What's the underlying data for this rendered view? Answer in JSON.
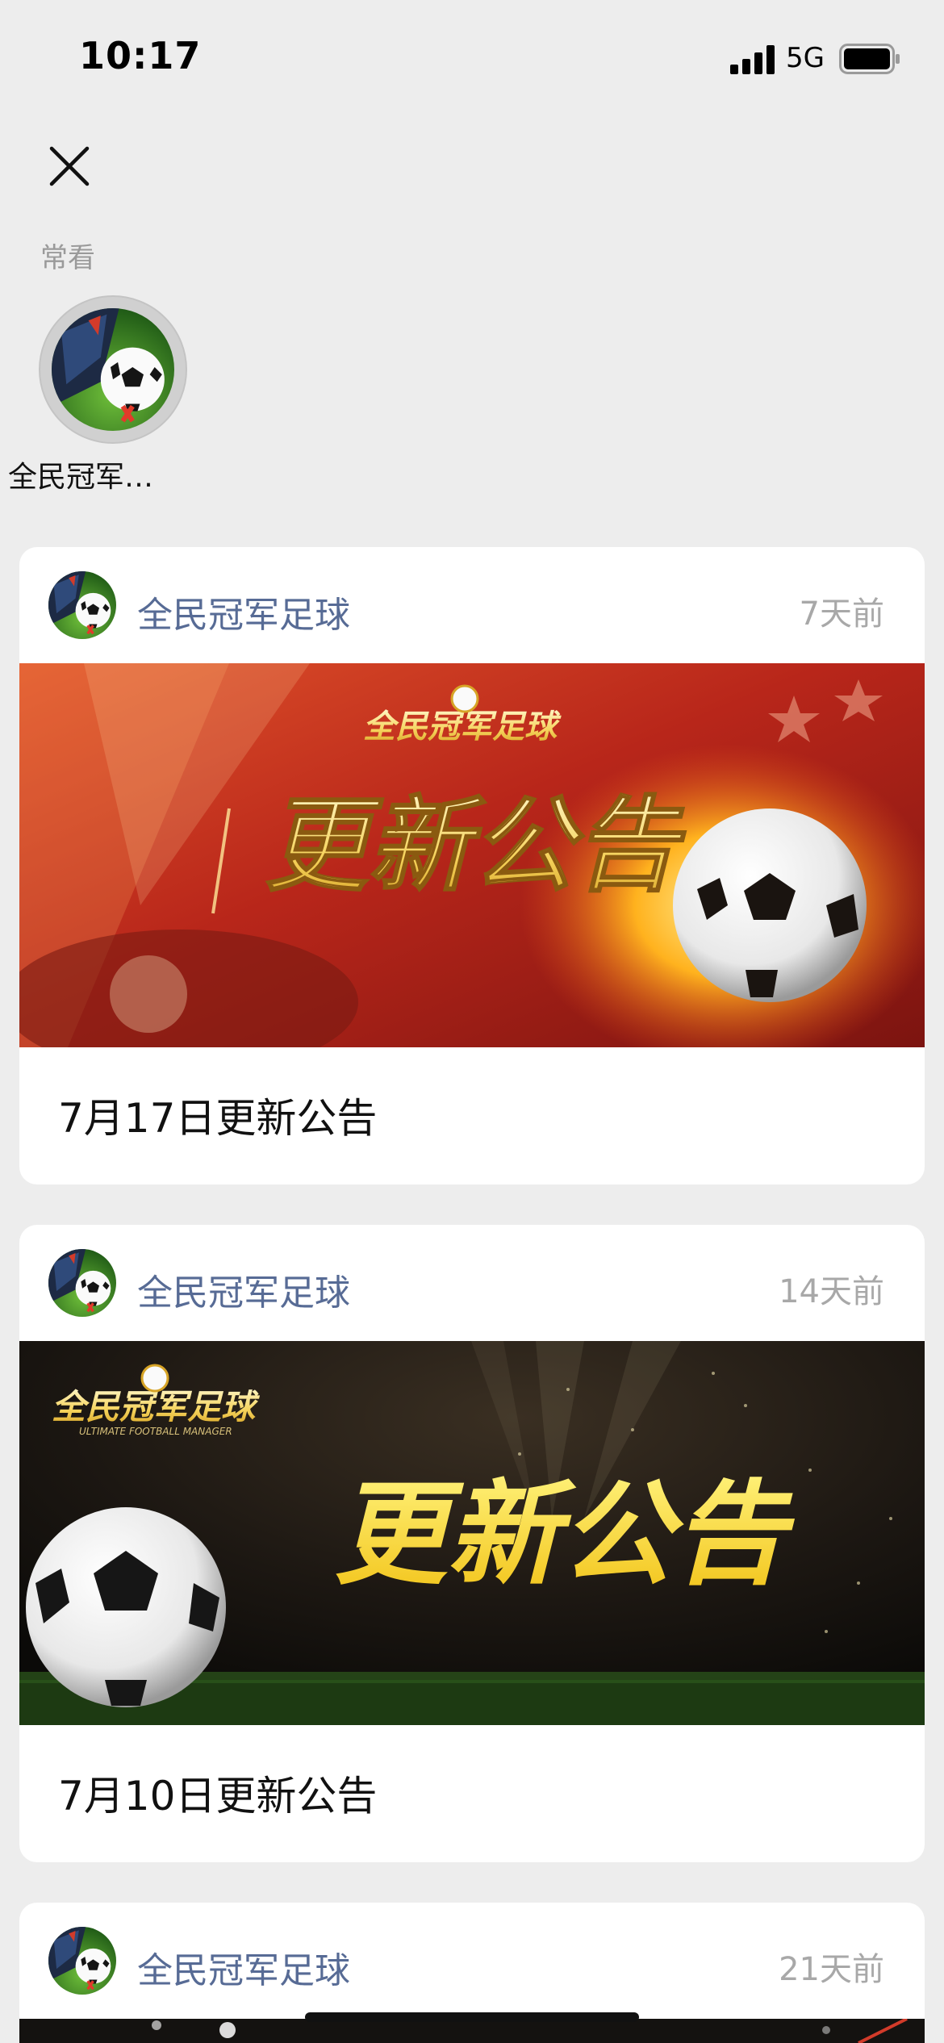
{
  "status_bar": {
    "time": "10:17",
    "network": "5G"
  },
  "frequent": {
    "section_label": "常看",
    "items": [
      {
        "name": "全民冠军…"
      }
    ]
  },
  "articles": [
    {
      "source": "全民冠军足球",
      "time": "7天前",
      "banner_logo": "全民冠军足球",
      "banner_text": "更新公告",
      "title": "7月17日更新公告"
    },
    {
      "source": "全民冠军足球",
      "time": "14天前",
      "banner_logo": "全民冠军足球",
      "banner_logo_sub": "ULTIMATE FOOTBALL MANAGER",
      "banner_text": "更新公告",
      "title": "7月10日更新公告"
    },
    {
      "source": "全民冠军足球",
      "time": "21天前"
    }
  ],
  "colors": {
    "background": "#ededed",
    "link_blue": "#576b95",
    "muted": "#a8a8a8"
  }
}
